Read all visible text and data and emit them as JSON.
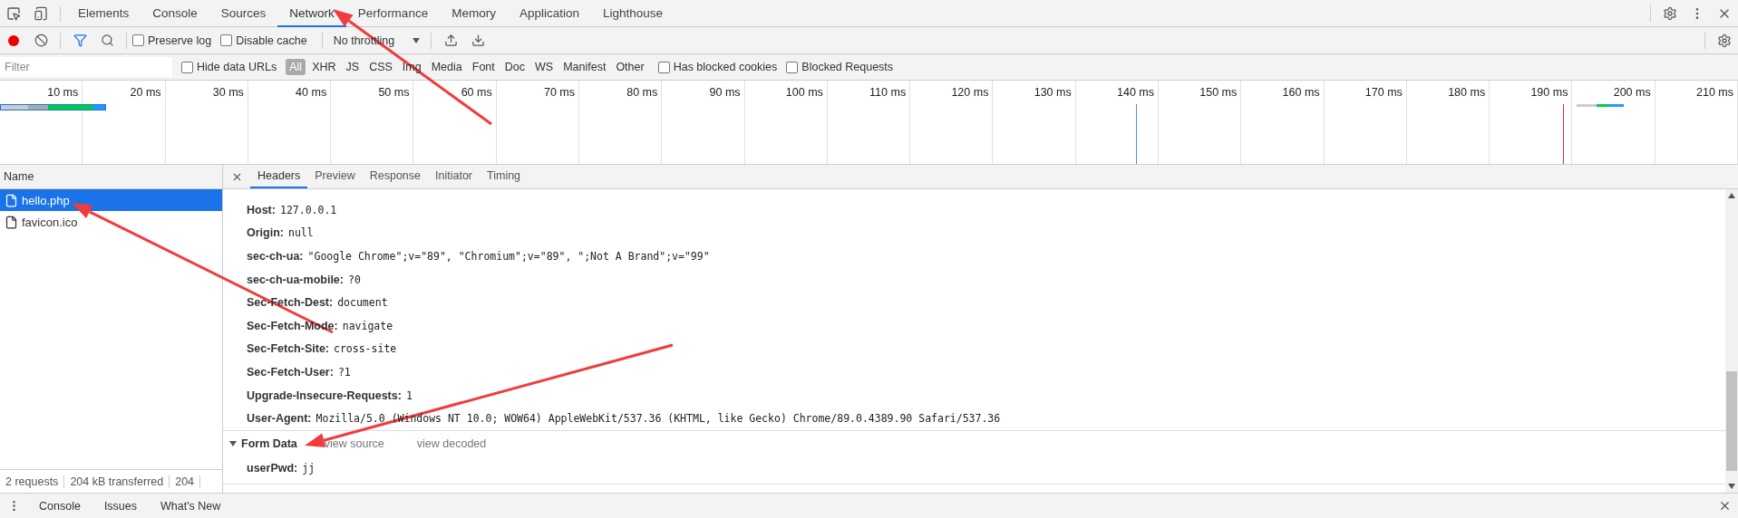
{
  "main_tabs": [
    {
      "label": "Elements",
      "selected": false
    },
    {
      "label": "Console",
      "selected": false
    },
    {
      "label": "Sources",
      "selected": false
    },
    {
      "label": "Network",
      "selected": true
    },
    {
      "label": "Performance",
      "selected": false
    },
    {
      "label": "Memory",
      "selected": false
    },
    {
      "label": "Application",
      "selected": false
    },
    {
      "label": "Lighthouse",
      "selected": false
    }
  ],
  "toolbar": {
    "recording": true,
    "filter_active": true,
    "preserve_log": {
      "label": "Preserve log",
      "checked": false
    },
    "disable_cache": {
      "label": "Disable cache",
      "checked": false
    },
    "throttling": "No throttling"
  },
  "filter_bar": {
    "placeholder": "Filter",
    "hide_data_urls": {
      "label": "Hide data URLs",
      "checked": false
    },
    "types": [
      {
        "label": "All",
        "selected": true
      },
      {
        "label": "XHR",
        "selected": false
      },
      {
        "label": "JS",
        "selected": false
      },
      {
        "label": "CSS",
        "selected": false
      },
      {
        "label": "Img",
        "selected": false
      },
      {
        "label": "Media",
        "selected": false
      },
      {
        "label": "Font",
        "selected": false
      },
      {
        "label": "Doc",
        "selected": false
      },
      {
        "label": "WS",
        "selected": false
      },
      {
        "label": "Manifest",
        "selected": false
      },
      {
        "label": "Other",
        "selected": false
      }
    ],
    "has_blocked_cookies": {
      "label": "Has blocked cookies",
      "checked": false
    },
    "blocked_requests": {
      "label": "Blocked Requests",
      "checked": false
    }
  },
  "timeline": {
    "ticks": [
      "10 ms",
      "20 ms",
      "30 ms",
      "40 ms",
      "50 ms",
      "60 ms",
      "70 ms",
      "80 ms",
      "90 ms",
      "100 ms",
      "110 ms",
      "120 ms",
      "130 ms",
      "140 ms",
      "150 ms",
      "160 ms",
      "170 ms",
      "180 ms",
      "190 ms",
      "200 ms",
      "210 ms"
    ]
  },
  "requests": {
    "column": "Name",
    "rows": [
      {
        "name": "hello.php",
        "selected": true
      },
      {
        "name": "favicon.ico",
        "selected": false
      }
    ]
  },
  "detail_tabs": [
    {
      "label": "Headers",
      "selected": true
    },
    {
      "label": "Preview",
      "selected": false
    },
    {
      "label": "Response",
      "selected": false
    },
    {
      "label": "Initiator",
      "selected": false
    },
    {
      "label": "Timing",
      "selected": false
    }
  ],
  "request_headers": [
    {
      "name": "Host:",
      "value": "127.0.0.1"
    },
    {
      "name": "Origin:",
      "value": "null"
    },
    {
      "name": "sec-ch-ua:",
      "value": "\"Google Chrome\";v=\"89\", \"Chromium\";v=\"89\", \";Not A Brand\";v=\"99\""
    },
    {
      "name": "sec-ch-ua-mobile:",
      "value": "?0"
    },
    {
      "name": "Sec-Fetch-Dest:",
      "value": "document"
    },
    {
      "name": "Sec-Fetch-Mode:",
      "value": "navigate"
    },
    {
      "name": "Sec-Fetch-Site:",
      "value": "cross-site"
    },
    {
      "name": "Sec-Fetch-User:",
      "value": "?1"
    },
    {
      "name": "Upgrade-Insecure-Requests:",
      "value": "1"
    },
    {
      "name": "User-Agent:",
      "value": "Mozilla/5.0 (Windows NT 10.0; WOW64) AppleWebKit/537.36 (KHTML, like Gecko) Chrome/89.0.4389.90 Safari/537.36"
    }
  ],
  "form_data": {
    "title": "Form Data",
    "expanded": true,
    "links": [
      "view source",
      "view decoded"
    ],
    "fields": [
      {
        "name": "userPwd:",
        "value": "jj"
      }
    ]
  },
  "status_bar": [
    "2 requests",
    "204 kB transferred",
    "204"
  ],
  "drawer_tabs": [
    "Console",
    "Issues",
    "What's New"
  ]
}
